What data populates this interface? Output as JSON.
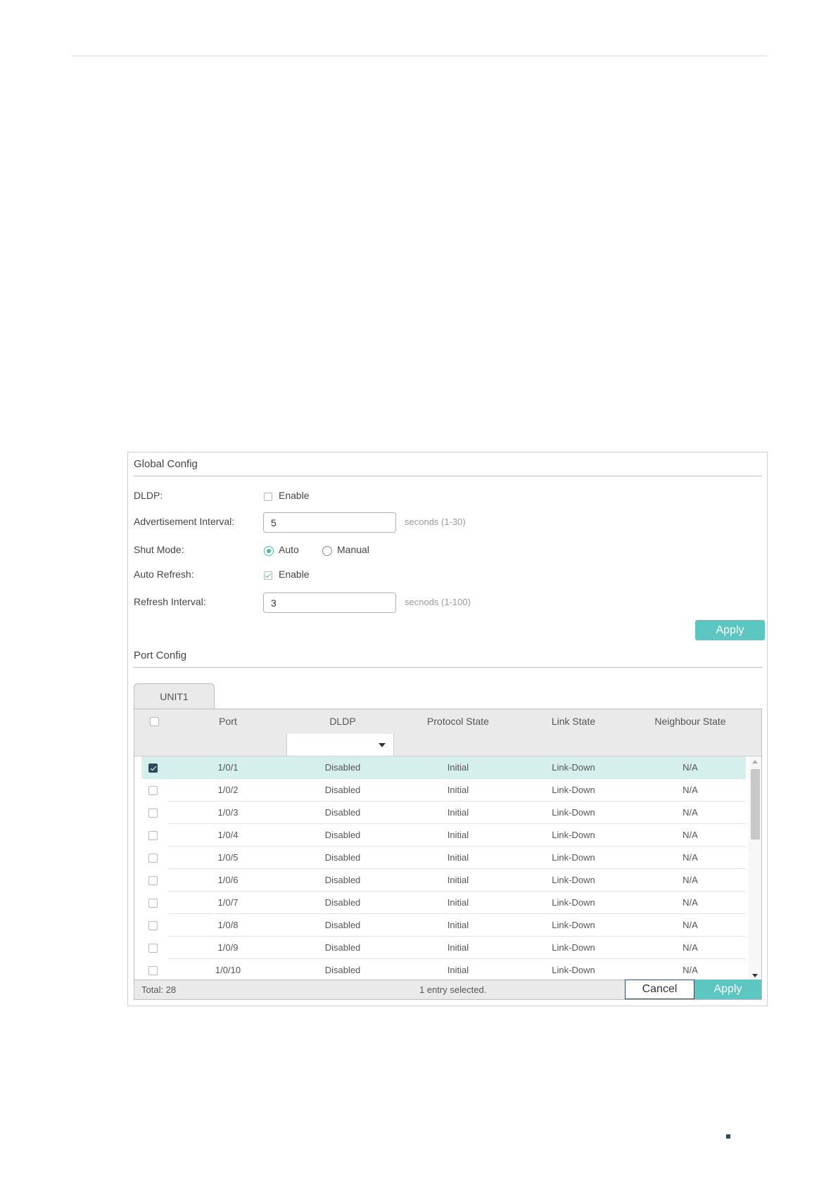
{
  "global_config": {
    "title": "Global Config",
    "dldp": {
      "label": "DLDP:",
      "option": "Enable",
      "checked": false
    },
    "advertisement_interval": {
      "label": "Advertisement Interval:",
      "value": "5",
      "hint": "seconds (1-30)"
    },
    "shut_mode": {
      "label": "Shut Mode:",
      "options": [
        "Auto",
        "Manual"
      ],
      "selected": "Auto"
    },
    "auto_refresh": {
      "label": "Auto Refresh:",
      "option": "Enable",
      "checked": true
    },
    "refresh_interval": {
      "label": "Refresh Interval:",
      "value": "3",
      "hint": "secnods (1-100)"
    },
    "apply_label": "Apply"
  },
  "port_config": {
    "title": "Port Config",
    "tab": "UNIT1",
    "columns": [
      "Port",
      "DLDP",
      "Protocol State",
      "Link State",
      "Neighbour State"
    ],
    "rows": [
      {
        "port": "1/0/1",
        "dldp": "Disabled",
        "protocol_state": "Initial",
        "link_state": "Link-Down",
        "neighbour_state": "N/A",
        "selected": true
      },
      {
        "port": "1/0/2",
        "dldp": "Disabled",
        "protocol_state": "Initial",
        "link_state": "Link-Down",
        "neighbour_state": "N/A",
        "selected": false
      },
      {
        "port": "1/0/3",
        "dldp": "Disabled",
        "protocol_state": "Initial",
        "link_state": "Link-Down",
        "neighbour_state": "N/A",
        "selected": false
      },
      {
        "port": "1/0/4",
        "dldp": "Disabled",
        "protocol_state": "Initial",
        "link_state": "Link-Down",
        "neighbour_state": "N/A",
        "selected": false
      },
      {
        "port": "1/0/5",
        "dldp": "Disabled",
        "protocol_state": "Initial",
        "link_state": "Link-Down",
        "neighbour_state": "N/A",
        "selected": false
      },
      {
        "port": "1/0/6",
        "dldp": "Disabled",
        "protocol_state": "Initial",
        "link_state": "Link-Down",
        "neighbour_state": "N/A",
        "selected": false
      },
      {
        "port": "1/0/7",
        "dldp": "Disabled",
        "protocol_state": "Initial",
        "link_state": "Link-Down",
        "neighbour_state": "N/A",
        "selected": false
      },
      {
        "port": "1/0/8",
        "dldp": "Disabled",
        "protocol_state": "Initial",
        "link_state": "Link-Down",
        "neighbour_state": "N/A",
        "selected": false
      },
      {
        "port": "1/0/9",
        "dldp": "Disabled",
        "protocol_state": "Initial",
        "link_state": "Link-Down",
        "neighbour_state": "N/A",
        "selected": false
      },
      {
        "port": "1/0/10",
        "dldp": "Disabled",
        "protocol_state": "Initial",
        "link_state": "Link-Down",
        "neighbour_state": "N/A",
        "selected": false
      }
    ],
    "total": "Total: 28",
    "selection_status": "1 entry selected.",
    "cancel_label": "Cancel",
    "apply_label": "Apply"
  },
  "colors": {
    "accent": "#5cc6c1",
    "selected_row": "#d5efec",
    "checkbox_checked": "#2f4a5e"
  }
}
